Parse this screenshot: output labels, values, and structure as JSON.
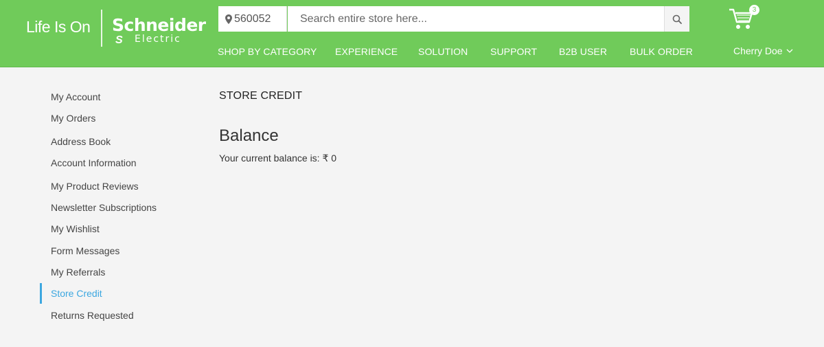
{
  "header": {
    "tagline": "Life Is On",
    "brand_name": "Schneider",
    "brand_sub": "Electric",
    "brand_mark": "S",
    "pincode": "560052",
    "search_placeholder": "Search entire store here...",
    "cart_count": "3",
    "user_name": "Cherry Doe",
    "nav": [
      {
        "label": "SHOP BY CATEGORY"
      },
      {
        "label": "EXPERIENCE"
      },
      {
        "label": "SOLUTION"
      },
      {
        "label": "SUPPORT"
      },
      {
        "label": "B2B USER"
      },
      {
        "label": "BULK ORDER"
      }
    ]
  },
  "sidebar": {
    "items": [
      {
        "label": "My Account"
      },
      {
        "label": "My Orders"
      },
      {
        "label": "Address Book"
      },
      {
        "label": "Account Information"
      },
      {
        "label": "My Product Reviews"
      },
      {
        "label": "Newsletter Subscriptions"
      },
      {
        "label": "My Wishlist"
      },
      {
        "label": "Form Messages"
      },
      {
        "label": "My Referrals"
      },
      {
        "label": "Store Credit"
      },
      {
        "label": "Returns Requested"
      }
    ],
    "active_item": "Store Credit"
  },
  "main": {
    "page_title": "STORE CREDIT",
    "section_title": "Balance",
    "balance_text": "Your current balance is: ₹ 0"
  },
  "colors": {
    "header_bg": "#70cb5a",
    "accent": "#3ca7e0",
    "page_bg": "#f4f4f4"
  }
}
